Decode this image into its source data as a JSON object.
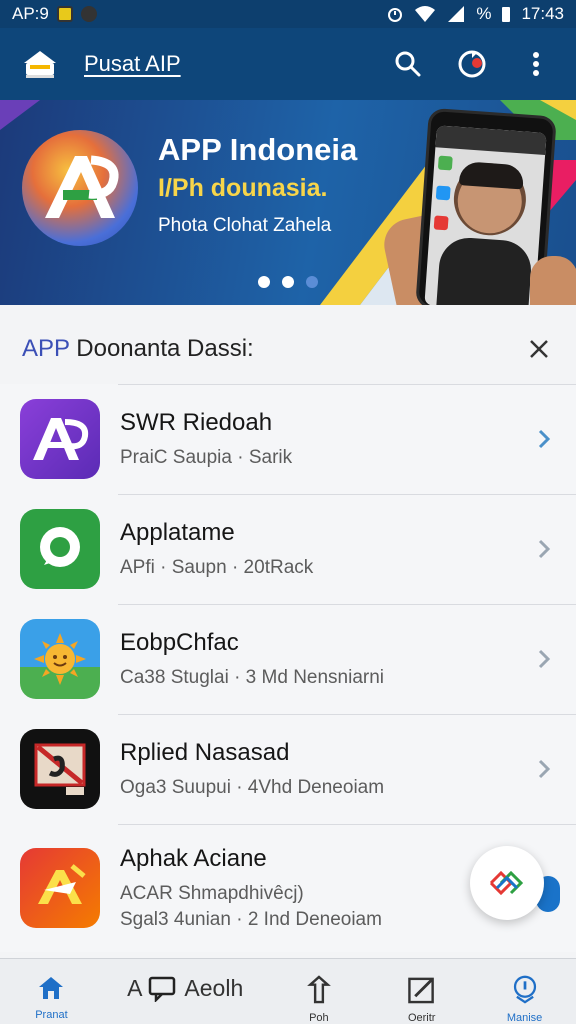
{
  "status_bar": {
    "carrier": "AP:9",
    "time": "17:43",
    "battery": "%"
  },
  "app_bar": {
    "title": "Pusat AIP"
  },
  "banner": {
    "title": "APP Indoneia",
    "subtitle": "I/Ph dounasia.",
    "tagline": "Phota Clohat Zahela",
    "active_slide": 0,
    "slide_count": 3
  },
  "list_header": {
    "title_accent": "APP",
    "title_rest": " Doonanta Dassi:"
  },
  "apps": [
    {
      "title": "SWR Riedoah",
      "subtitle": "PraiC Saupia · Sarik",
      "subtitle2": ""
    },
    {
      "title": "Applatame",
      "subtitle": "APfi · Saupn · 20tRack",
      "subtitle2": ""
    },
    {
      "title": "EobpChfac",
      "subtitle": "Ca38 Stuglai · 3 Md  Nensniarni",
      "subtitle2": ""
    },
    {
      "title": "Rplied Nasasad",
      "subtitle": "Oga3 Suupui · 4Vhd  Deneoiam",
      "subtitle2": ""
    },
    {
      "title": "Aphak Aciane",
      "subtitle": "ACAR Shmapdhivêcj)",
      "subtitle2": "Sgal3 4unian · 2 Ind  Deneoiam"
    }
  ],
  "bottom_nav": {
    "items": [
      {
        "label": "Pranat"
      },
      {
        "label": "Aeolh",
        "prefix": "A"
      },
      {
        "label": "Poh"
      },
      {
        "label": "Oeritr"
      },
      {
        "label": "Manise"
      }
    ]
  },
  "colors": {
    "app_bar": "#0e467a",
    "accent": "#3b4fb6",
    "chevron": "#4a90c9",
    "nav_active": "#1f6fc7"
  },
  "icons": [
    "home-icon",
    "chat-icon",
    "share-icon",
    "edit-icon",
    "shield-icon",
    "search-icon",
    "refresh-icon",
    "more-vert-icon",
    "close-icon",
    "chevron-right-icon"
  ]
}
